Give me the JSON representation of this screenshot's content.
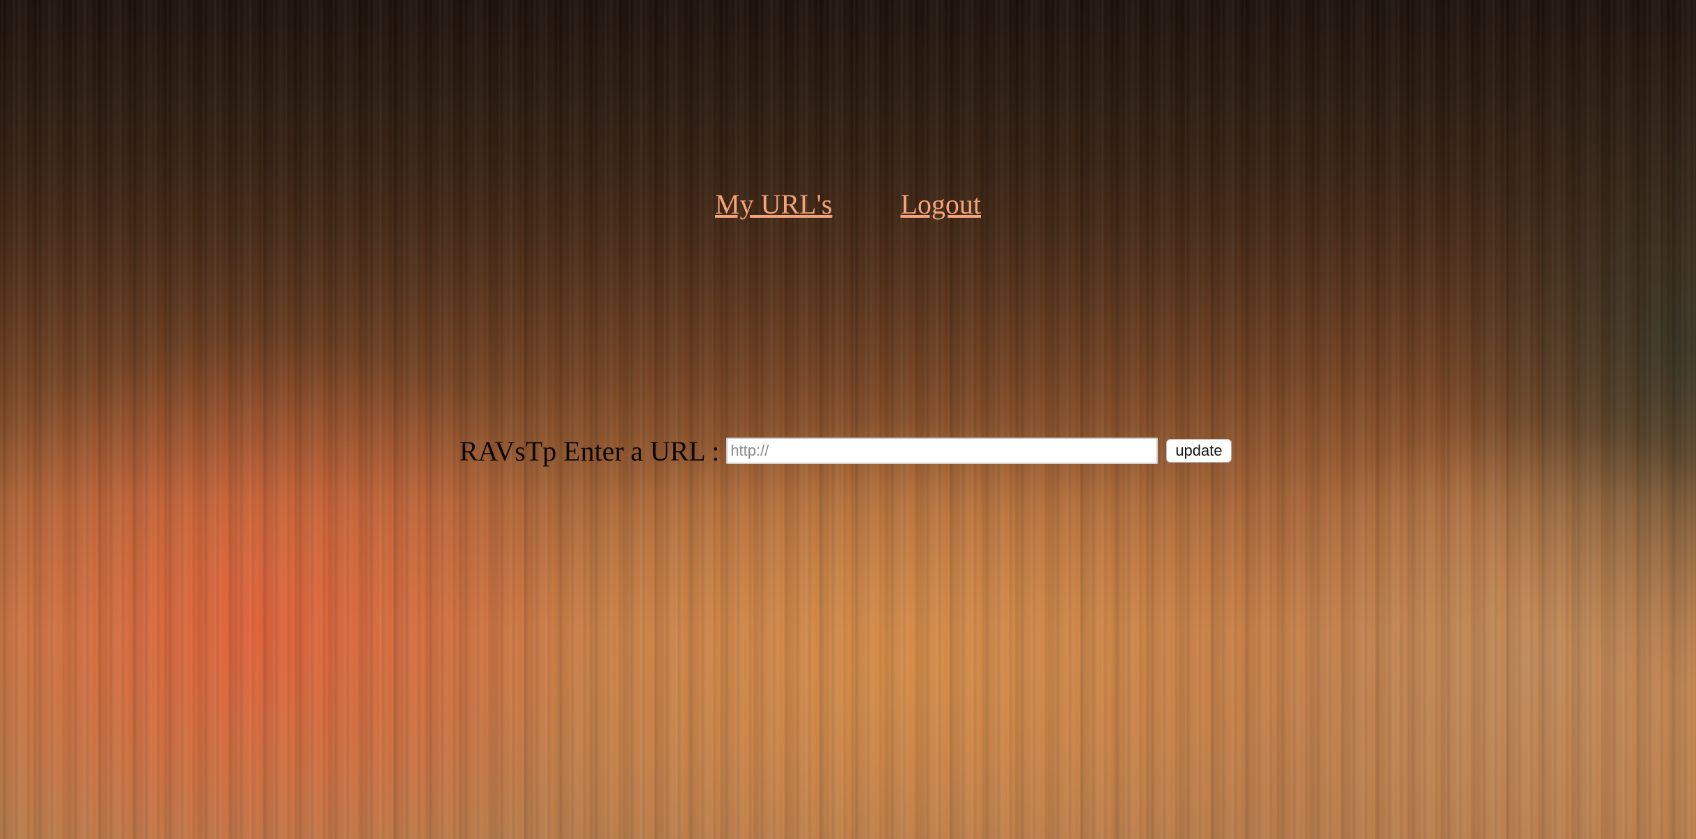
{
  "nav": {
    "links": [
      {
        "label": "My URL's "
      },
      {
        "label": "Logout"
      }
    ],
    "link_color": "#f5a37a"
  },
  "form": {
    "label": "RAVsTp Enter a URL :",
    "url_input": {
      "value": "",
      "placeholder": "http://"
    },
    "submit_label": "update"
  }
}
